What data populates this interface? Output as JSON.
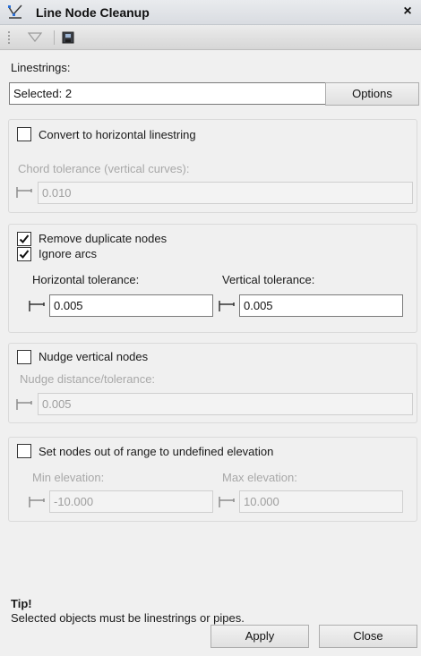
{
  "window": {
    "title": "Line Node Cleanup",
    "close_glyph": "×"
  },
  "toolbar": {
    "icons": [
      "funnel-icon",
      "save-icon"
    ]
  },
  "linestrings": {
    "label": "Linestrings:",
    "value": "Selected: 2",
    "options_button": "Options"
  },
  "horizontal_group": {
    "checkbox_label": "Convert to horizontal linestring",
    "checked": false,
    "chord_label": "Chord tolerance (vertical curves):",
    "chord_value": "0.010"
  },
  "duplicate_group": {
    "remove_label": "Remove duplicate nodes",
    "remove_checked": true,
    "ignore_label": "Ignore arcs",
    "ignore_checked": true,
    "horizontal_label": "Horizontal tolerance:",
    "horizontal_value": "0.005",
    "vertical_label": "Vertical tolerance:",
    "vertical_value": "0.005"
  },
  "nudge_group": {
    "checkbox_label": "Nudge vertical nodes",
    "checked": false,
    "distance_label": "Nudge distance/tolerance:",
    "distance_value": "0.005"
  },
  "range_group": {
    "checkbox_label": "Set nodes out of range to undefined elevation",
    "checked": false,
    "min_label": "Min elevation:",
    "min_value": "-10.000",
    "max_label": "Max elevation:",
    "max_value": "10.000"
  },
  "tip": {
    "heading": "Tip!",
    "text": "Selected objects must be linestrings or pipes."
  },
  "footer": {
    "apply": "Apply",
    "close": "Close"
  }
}
